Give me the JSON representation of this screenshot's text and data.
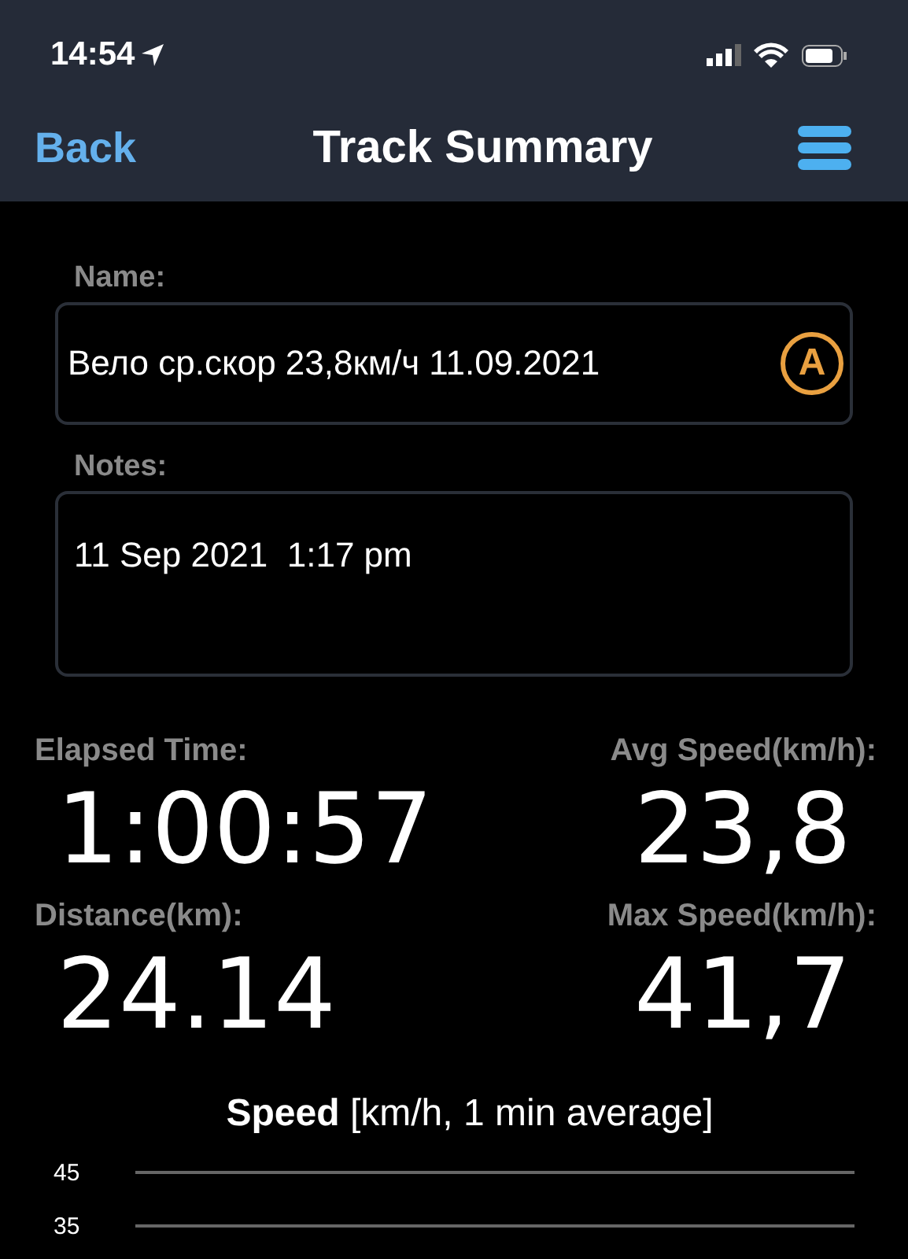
{
  "status_bar": {
    "time": "14:54"
  },
  "nav": {
    "back": "Back",
    "title": "Track Summary"
  },
  "name": {
    "label": "Name:",
    "value": "Вело ср.скор 23,8км/ч 11.09.2021",
    "badge": "A"
  },
  "notes": {
    "label": "Notes:",
    "value": "11 Sep 2021  1:17 pm"
  },
  "stats": [
    {
      "label": "Elapsed Time:",
      "value": "1:00:57"
    },
    {
      "label": "Avg Speed(km/h):",
      "value": "23,8"
    },
    {
      "label": "Distance(km):",
      "value": "24.14"
    },
    {
      "label": "Max Speed(km/h):",
      "value": "41,7"
    }
  ],
  "chart": {
    "title": "**Speed** [km/h, 1 min average]",
    "gridlines": [
      "45",
      "35"
    ]
  }
}
